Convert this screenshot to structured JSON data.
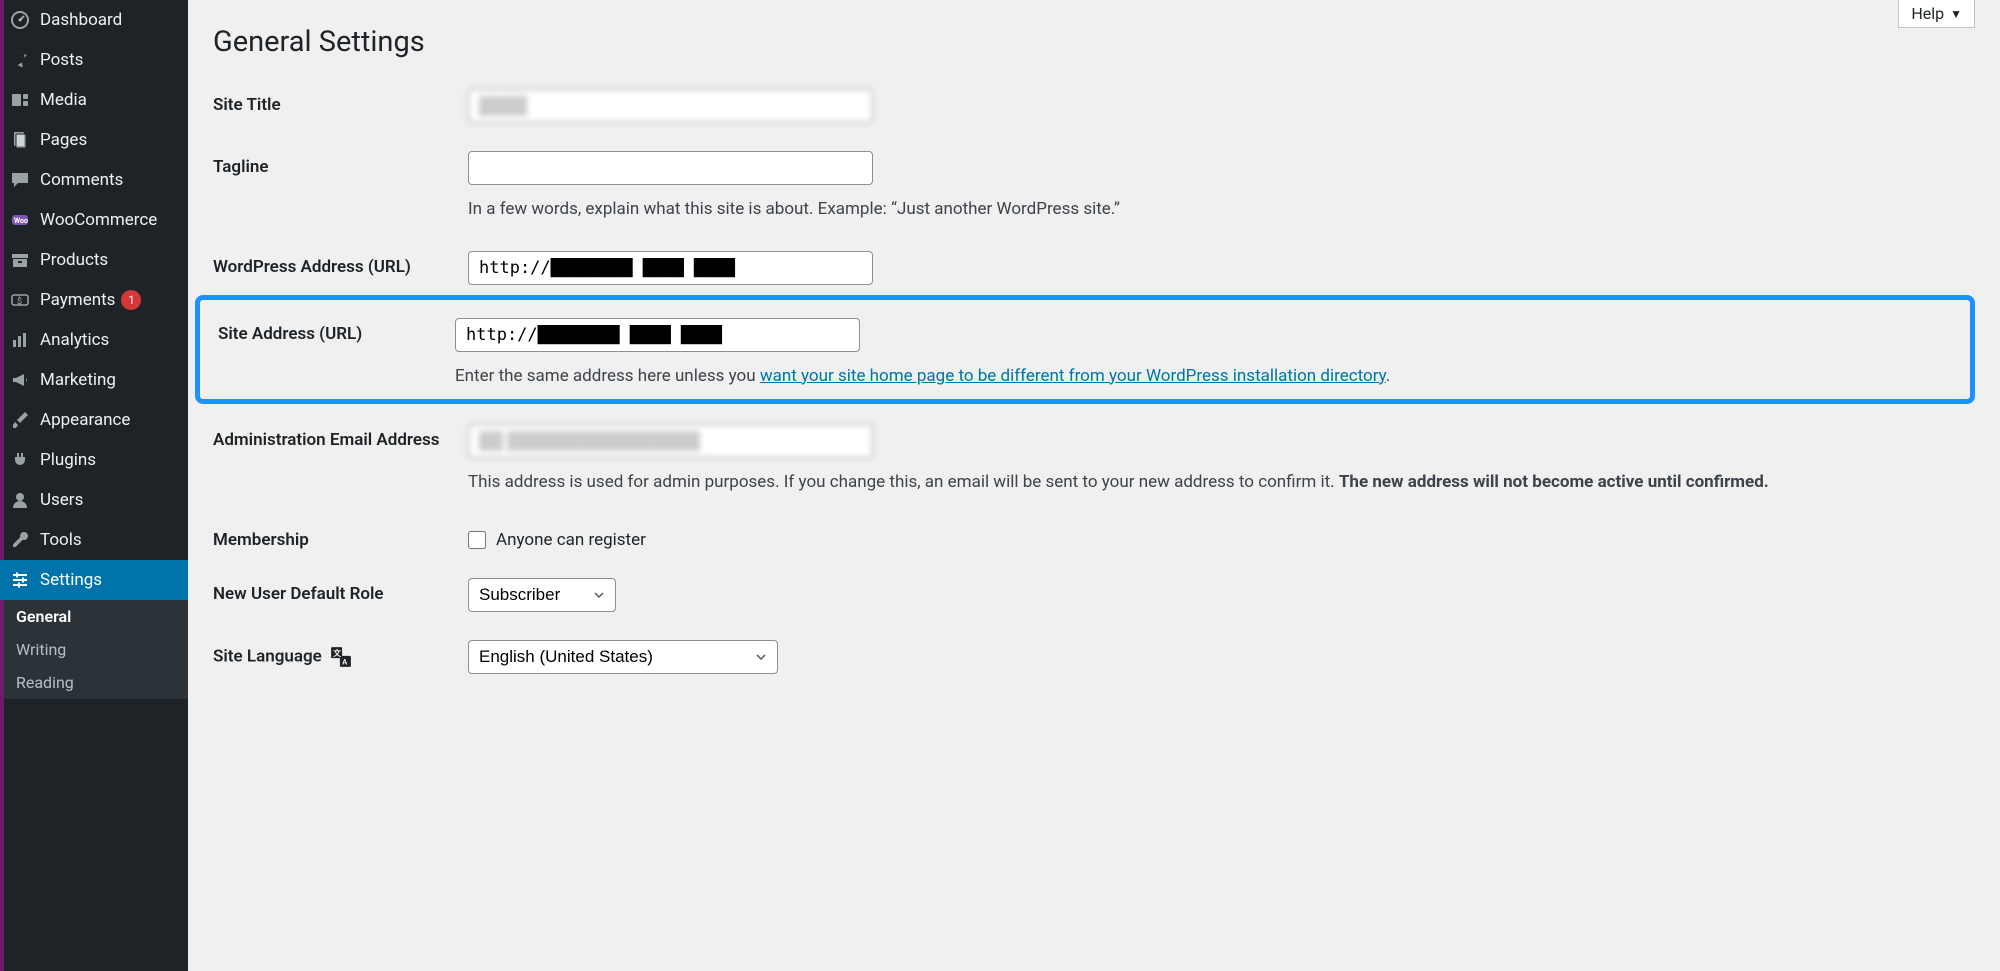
{
  "help_label": "Help",
  "page_title": "General Settings",
  "sidebar": [
    {
      "key": "dashboard",
      "label": "Dashboard",
      "icon": "dashboard"
    },
    {
      "key": "posts",
      "label": "Posts",
      "icon": "pin"
    },
    {
      "key": "media",
      "label": "Media",
      "icon": "media"
    },
    {
      "key": "pages",
      "label": "Pages",
      "icon": "pages"
    },
    {
      "key": "comments",
      "label": "Comments",
      "icon": "comment"
    },
    {
      "key": "woocommerce",
      "label": "WooCommerce",
      "icon": "woo"
    },
    {
      "key": "products",
      "label": "Products",
      "icon": "archive"
    },
    {
      "key": "payments",
      "label": "Payments",
      "icon": "dollar",
      "badge": "1"
    },
    {
      "key": "analytics",
      "label": "Analytics",
      "icon": "chart"
    },
    {
      "key": "marketing",
      "label": "Marketing",
      "icon": "megaphone"
    },
    {
      "key": "appearance",
      "label": "Appearance",
      "icon": "brush"
    },
    {
      "key": "plugins",
      "label": "Plugins",
      "icon": "plug"
    },
    {
      "key": "users",
      "label": "Users",
      "icon": "user"
    },
    {
      "key": "tools",
      "label": "Tools",
      "icon": "wrench"
    },
    {
      "key": "settings",
      "label": "Settings",
      "icon": "sliders",
      "active": true
    }
  ],
  "submenu": [
    {
      "label": "General",
      "current": true
    },
    {
      "label": "Writing"
    },
    {
      "label": "Reading"
    }
  ],
  "fields": {
    "site_title": {
      "label": "Site Title",
      "value": "████"
    },
    "tagline": {
      "label": "Tagline",
      "value": "",
      "help": "In a few words, explain what this site is about. Example: “Just another WordPress site.”"
    },
    "wp_address": {
      "label": "WordPress Address (URL)",
      "value": "http://████████ ████ ████"
    },
    "site_address": {
      "label": "Site Address (URL)",
      "value": "http://████████ ████ ████",
      "help_pre": "Enter the same address here unless you ",
      "help_link": "want your site home page to be different from your WordPress installation directory",
      "help_post": "."
    },
    "admin_email": {
      "label": "Administration Email Address",
      "value": "██ ████████████████",
      "help_pre": "This address is used for admin purposes. If you change this, an email will be sent to your new address to confirm it. ",
      "help_bold": "The new address will not become active until confirmed."
    },
    "membership": {
      "label": "Membership",
      "checkbox_label": "Anyone can register",
      "checked": false
    },
    "default_role": {
      "label": "New User Default Role",
      "value": "Subscriber"
    },
    "site_language": {
      "label": "Site Language",
      "value": "English (United States)"
    }
  }
}
